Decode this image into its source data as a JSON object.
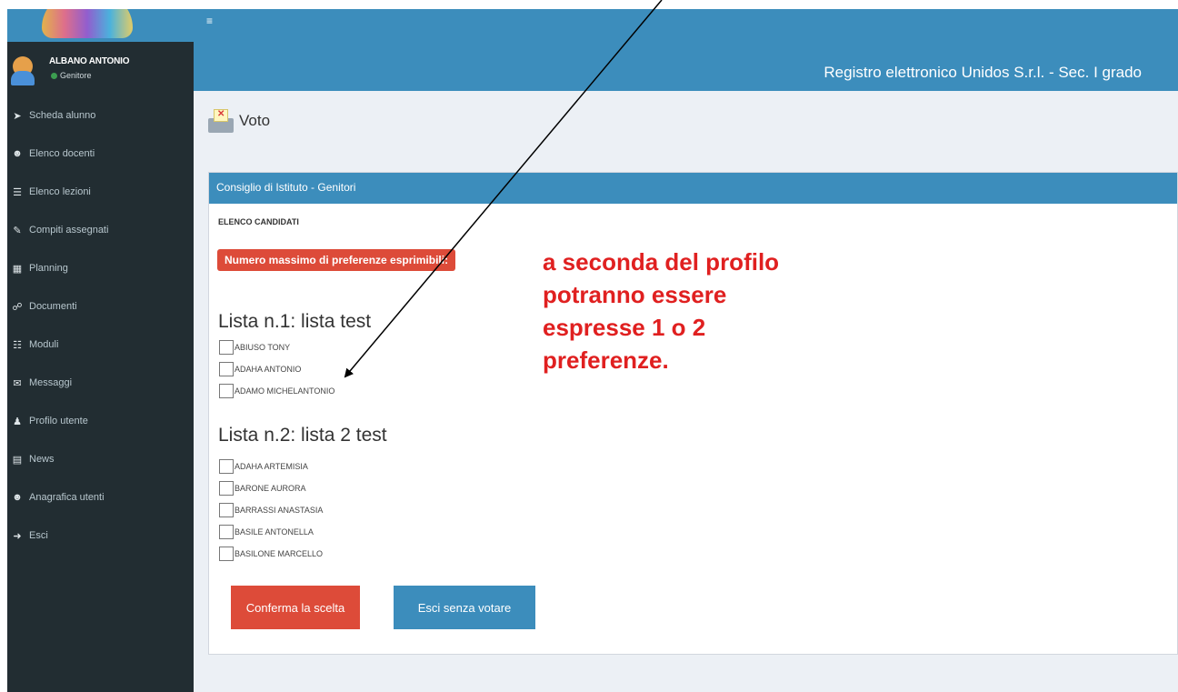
{
  "sidebar": {
    "user": {
      "name": "ALBANO ANTONIO",
      "role": "Genitore"
    },
    "items": [
      {
        "label": "Scheda alunno",
        "icon": "arrow-icon"
      },
      {
        "label": "Elenco docenti",
        "icon": "users-icon"
      },
      {
        "label": "Elenco lezioni",
        "icon": "list-icon"
      },
      {
        "label": "Compiti assegnati",
        "icon": "edit-icon"
      },
      {
        "label": "Planning",
        "icon": "calendar-icon"
      },
      {
        "label": "Documenti",
        "icon": "paperclip-icon"
      },
      {
        "label": "Moduli",
        "icon": "table-icon"
      },
      {
        "label": "Messaggi",
        "icon": "envelope-icon"
      },
      {
        "label": "Profilo utente",
        "icon": "user-icon"
      },
      {
        "label": "News",
        "icon": "newspaper-icon"
      },
      {
        "label": "Anagrafica utenti",
        "icon": "users-icon"
      },
      {
        "label": "Esci",
        "icon": "logout-icon"
      }
    ]
  },
  "header": {
    "menu_icon": "≡",
    "title": "Registro elettronico Unidos S.r.l. - Sec. I grado"
  },
  "page": {
    "title": "Voto"
  },
  "box": {
    "header": "Consiglio di Istituto - Genitori",
    "section_label": "ELENCO CANDIDATI",
    "max_preferences_label": "Numero massimo di preferenze esprimibili:",
    "lists": [
      {
        "title": "Lista n.1: lista test",
        "candidates": [
          "ABIUSO TONY",
          "ADAHA ANTONIO",
          "ADAMO MICHELANTONIO"
        ]
      },
      {
        "title": "Lista n.2: lista 2 test",
        "candidates": [
          "ADAHA ARTEMISIA",
          "BARONE AURORA",
          "BARRASSI ANASTASIA",
          "BASILE ANTONELLA",
          "BASILONE MARCELLO"
        ]
      }
    ],
    "confirm_button": "Conferma la scelta",
    "exit_button": "Esci senza votare"
  },
  "annotation": {
    "lines": [
      "a seconda del profilo",
      "potranno essere",
      "espresse 1 o 2",
      "preferenze."
    ],
    "color": "#e02020"
  },
  "colors": {
    "primary": "#3c8dbc",
    "danger": "#dd4b39",
    "sidebar": "#222d32",
    "content_bg": "#ecf0f5"
  }
}
